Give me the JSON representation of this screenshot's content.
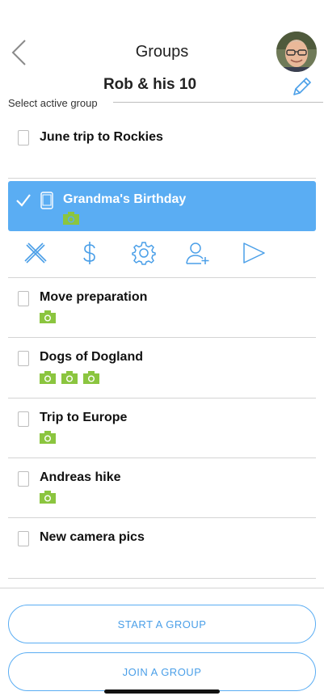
{
  "nav": {
    "title": "Groups"
  },
  "account": {
    "name": "Rob & his 10"
  },
  "select_label": "Select active group",
  "groups": [
    {
      "title": "June trip to Rockies",
      "cameras": 0
    },
    {
      "title": "Grandma's Birthday",
      "cameras": 1,
      "active": true
    },
    {
      "title": "Move preparation",
      "cameras": 1
    },
    {
      "title": "Dogs of Dogland",
      "cameras": 3
    },
    {
      "title": "Trip to Europe",
      "cameras": 1
    },
    {
      "title": "Andreas hike",
      "cameras": 1
    },
    {
      "title": "New camera pics",
      "cameras": 0
    }
  ],
  "toolbar": [
    "close-icon",
    "dollar-icon",
    "gear-icon",
    "add-user-icon",
    "play-icon"
  ],
  "buttons": {
    "start": "START A GROUP",
    "join": "JOIN A GROUP"
  },
  "colors": {
    "accent": "#5aadf3",
    "camera_green": "#8bc53f",
    "text_blue": "#4a9fe8"
  }
}
